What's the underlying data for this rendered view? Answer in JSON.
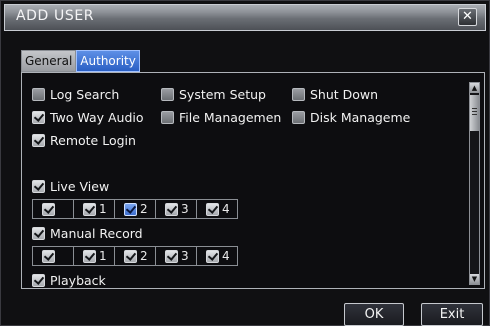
{
  "window": {
    "title": "ADD USER",
    "close_icon": "close-icon"
  },
  "tabs": [
    {
      "label": "General",
      "active": false
    },
    {
      "label": "Authority",
      "active": true
    }
  ],
  "permissions": {
    "log_search": {
      "label": "Log Search",
      "checked": false
    },
    "system_setup": {
      "label": "System Setup",
      "checked": false
    },
    "shut_down": {
      "label": "Shut Down",
      "checked": false
    },
    "two_way_audio": {
      "label": "Two Way Audio",
      "checked": true
    },
    "file_management": {
      "label": "File Managemen",
      "checked": false
    },
    "disk_management": {
      "label": "Disk Manageme",
      "checked": false
    },
    "remote_login": {
      "label": "Remote Login",
      "checked": true
    },
    "live_view": {
      "label": "Live View",
      "checked": true
    },
    "manual_record": {
      "label": "Manual Record",
      "checked": true
    },
    "playback": {
      "label": "Playback",
      "checked": true
    }
  },
  "channels": {
    "live_view": [
      "",
      "1",
      "2",
      "3",
      "4"
    ],
    "manual_record": [
      "",
      "1",
      "2",
      "3",
      "4"
    ]
  },
  "buttons": {
    "ok": "OK",
    "exit": "Exit"
  },
  "colors": {
    "active_tab": "#2a5fc4",
    "highlight_checkbox": "#3d6fd0"
  }
}
